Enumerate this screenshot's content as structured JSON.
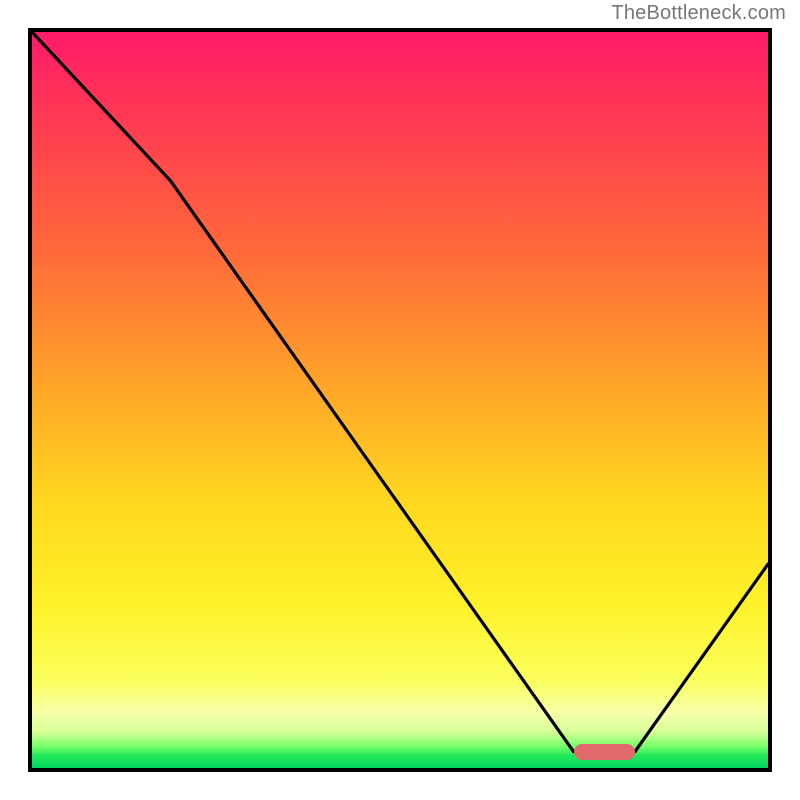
{
  "watermark": "TheBottleneck.com",
  "chart_data": {
    "type": "line",
    "title": "",
    "xlabel": "",
    "ylabel": "",
    "xlim": [
      0,
      100
    ],
    "ylim": [
      0,
      100
    ],
    "grid": false,
    "legend": false,
    "series": [
      {
        "name": "bottleneck-curve",
        "x": [
          0.0,
          18.8,
          73.6,
          81.9,
          100.0
        ],
        "y": [
          100.0,
          79.8,
          2.2,
          2.2,
          27.7
        ]
      }
    ],
    "optimal_marker": {
      "x_start": 73.6,
      "x_end": 81.9,
      "y": 2.2
    },
    "background_gradient_stops": [
      {
        "pos": 0,
        "color": "#ff1a6a"
      },
      {
        "pos": 12,
        "color": "#ff3a52"
      },
      {
        "pos": 30,
        "color": "#ff6a3a"
      },
      {
        "pos": 48,
        "color": "#ffa529"
      },
      {
        "pos": 64,
        "color": "#ffd81f"
      },
      {
        "pos": 78,
        "color": "#fff22a"
      },
      {
        "pos": 88,
        "color": "#fbff5c"
      },
      {
        "pos": 92.5,
        "color": "#f6ffa8"
      },
      {
        "pos": 95,
        "color": "#d9ff9a"
      },
      {
        "pos": 97,
        "color": "#7cff6a"
      },
      {
        "pos": 98.3,
        "color": "#24e85b"
      },
      {
        "pos": 100,
        "color": "#00d860"
      }
    ]
  }
}
